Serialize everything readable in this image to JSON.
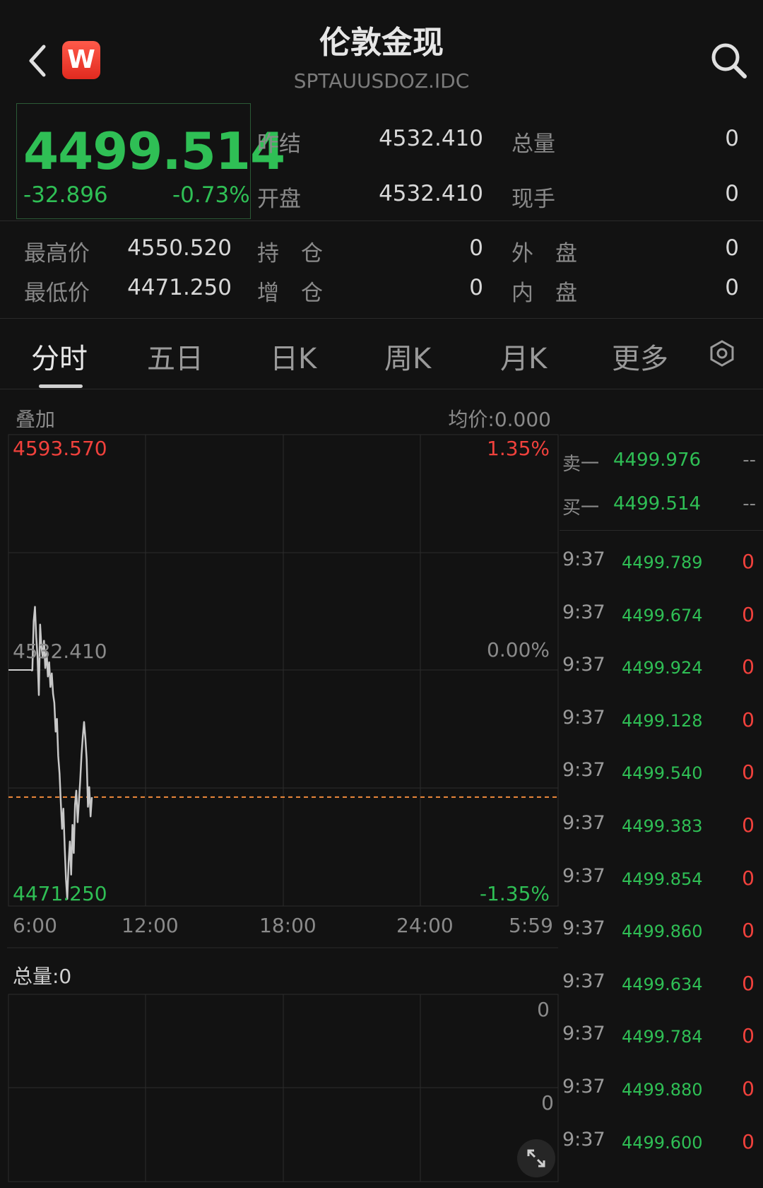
{
  "header": {
    "title": "伦敦金现",
    "subtitle": "SPTAUUSDOZ.IDC",
    "logo_text": "W"
  },
  "quote": {
    "price": "4499.514",
    "change": "-32.896",
    "change_pct": "-0.73%",
    "rows": [
      {
        "l1": "昨结",
        "v1": "4532.410",
        "l2": "总量",
        "v2": "0"
      },
      {
        "l1": "开盘",
        "v1": "4532.410",
        "l2": "现手",
        "v2": "0"
      }
    ],
    "rows2": [
      {
        "l0": "最高价",
        "v0": "4550.520",
        "l1": "持　仓",
        "v1": "0",
        "l2": "外　盘",
        "v2": "0"
      },
      {
        "l0": "最低价",
        "v0": "4471.250",
        "l1": "增　仓",
        "v1": "0",
        "l2": "内　盘",
        "v2": "0"
      }
    ]
  },
  "tabs": [
    "分时",
    "五日",
    "日K",
    "周K",
    "月K",
    "更多"
  ],
  "chart": {
    "overlay_label": "叠加",
    "avg_label": "均价:0.000",
    "top_price": "4593.570",
    "top_pct": "1.35%",
    "mid_price": "4532.410",
    "mid_pct": "0.00%",
    "bottom_price": "4471.250",
    "bottom_pct": "-1.35%",
    "time_labels": [
      "6:00",
      "12:00",
      "18:00",
      "24:00",
      "5:59"
    ],
    "volume_label": "总量:0",
    "vol_top": "0",
    "vol_mid": "0",
    "colors": {
      "line": "#c8c8c8",
      "ref_line": "#f08a3c",
      "up": "#f0413c",
      "down": "#2fbf55"
    }
  },
  "chart_data": {
    "type": "line",
    "series": [
      {
        "values": [
          4532.41,
          4532.41,
          4545.2,
          4548.9,
          4541.0,
          4536.2,
          4526.0,
          4544.3,
          4538.5,
          4536.0,
          4540.1,
          4533.0,
          4537.2,
          4530.8,
          4534.5,
          4528.1,
          4531.6,
          4526.3,
          4524.0,
          4516.5,
          4519.8,
          4510.2,
          4505.6,
          4498.0,
          4491.3,
          4496.5,
          4486.4,
          4478.2,
          4473.1,
          4482.5,
          4488.0,
          4479.4,
          4492.3,
          4485.0,
          4497.6,
          4501.2,
          4493.0,
          4498.3,
          4503.7,
          4510.5,
          4515.2,
          4519.0,
          4514.6,
          4509.3,
          4497.0,
          4502.1,
          4494.5,
          4499.514
        ]
      }
    ],
    "ylim": [
      4471.25,
      4593.57
    ],
    "reference": 4532.41,
    "current": 4499.514
  },
  "orderbook": {
    "ask": {
      "label": "卖一",
      "price": "4499.976",
      "vol": "--"
    },
    "bid": {
      "label": "买一",
      "price": "4499.514",
      "vol": "--"
    },
    "ticks": [
      {
        "time": "9:37",
        "price": "4499.789",
        "vol": "0"
      },
      {
        "time": "9:37",
        "price": "4499.674",
        "vol": "0"
      },
      {
        "time": "9:37",
        "price": "4499.924",
        "vol": "0"
      },
      {
        "time": "9:37",
        "price": "4499.128",
        "vol": "0"
      },
      {
        "time": "9:37",
        "price": "4499.540",
        "vol": "0"
      },
      {
        "time": "9:37",
        "price": "4499.383",
        "vol": "0"
      },
      {
        "time": "9:37",
        "price": "4499.854",
        "vol": "0"
      },
      {
        "time": "9:37",
        "price": "4499.860",
        "vol": "0"
      },
      {
        "time": "9:37",
        "price": "4499.634",
        "vol": "0"
      },
      {
        "time": "9:37",
        "price": "4499.784",
        "vol": "0"
      },
      {
        "time": "9:37",
        "price": "4499.880",
        "vol": "0"
      },
      {
        "time": "9:37",
        "price": "4499.600",
        "vol": "0"
      }
    ]
  }
}
